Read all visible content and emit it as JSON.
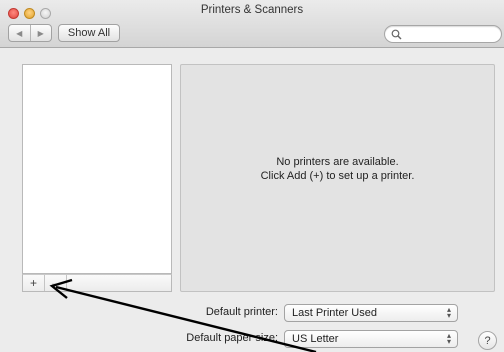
{
  "window": {
    "title": "Printers & Scanners"
  },
  "toolbar": {
    "back_icon": "◀",
    "forward_icon": "▶",
    "show_all_label": "Show All",
    "search_placeholder": ""
  },
  "printer_list": {
    "items": [],
    "add_label": "+",
    "remove_label": "–"
  },
  "detail": {
    "empty_line1": "No printers are available.",
    "empty_line2": "Click Add (+) to set up a printer."
  },
  "settings": {
    "default_printer_label": "Default printer:",
    "default_printer_value": "Last Printer Used",
    "default_paper_label": "Default paper size:",
    "default_paper_value": "US Letter"
  },
  "help_label": "?",
  "annotation": {
    "arrow_color": "#000000"
  }
}
